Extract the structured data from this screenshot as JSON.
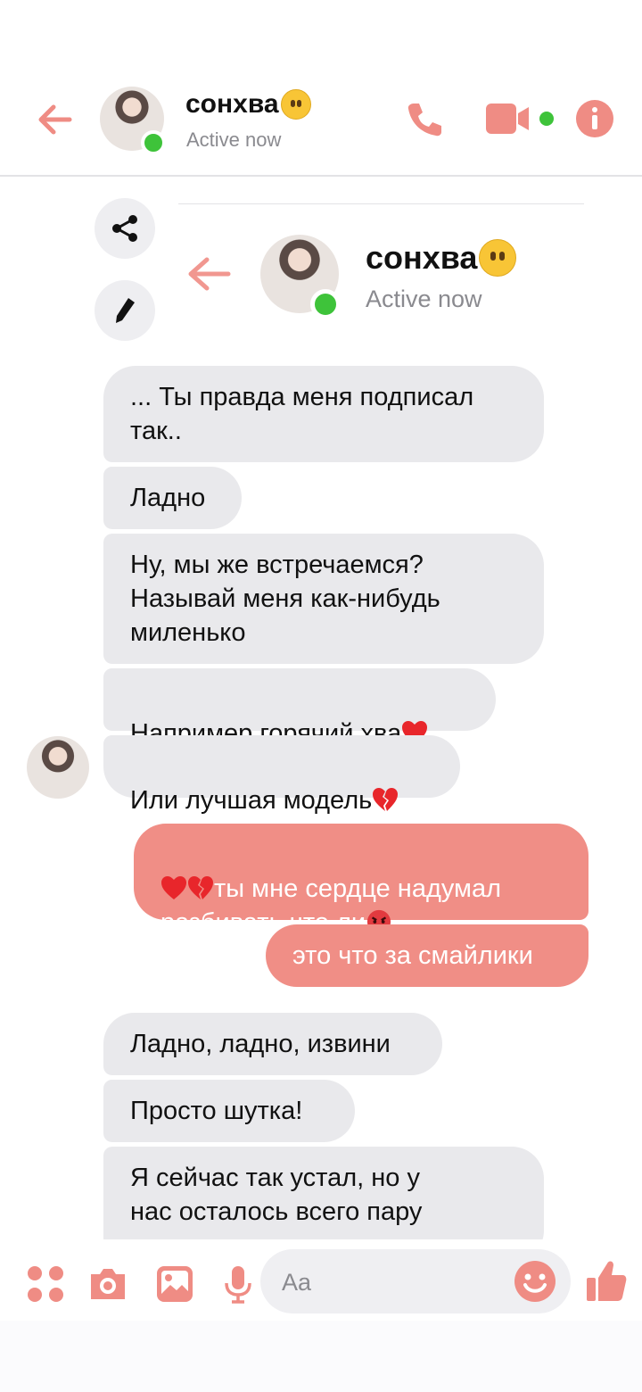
{
  "header": {
    "name": "сонхва",
    "status": "Active now"
  },
  "embedded": {
    "name": "сонхва",
    "status": "Active now"
  },
  "messages": [
    {
      "text": "... Ты правда меня подписал\nтак..",
      "from": "them"
    },
    {
      "text": "Ладно",
      "from": "them"
    },
    {
      "text": "Ну, мы же встречаемся?\nНазывай меня как-нибудь\nмиленько",
      "from": "them"
    },
    {
      "text": "Например горячий хва",
      "from": "them",
      "emoji": "red-heart"
    },
    {
      "text": "Или лучшая модель",
      "from": "them",
      "emoji": "broken-heart"
    },
    {
      "text": "ты мне сердце надумал\nразбивать что ли",
      "from": "me"
    },
    {
      "text": "это что за смайлики",
      "from": "me"
    },
    {
      "text": "Ладно, ладно, извини",
      "from": "them"
    },
    {
      "text": "Просто шутка!",
      "from": "them"
    },
    {
      "text": "Я сейчас так устал, но у\nнас осталось всего пару",
      "from": "them"
    }
  ],
  "composer": {
    "placeholder": "Aa"
  },
  "colors": {
    "accent": "#f08e86",
    "online": "#3ec33a",
    "incoming_bubble": "#e9e9ec"
  }
}
